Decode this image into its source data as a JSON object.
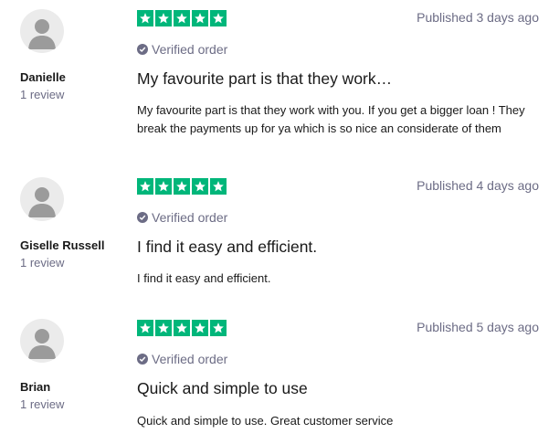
{
  "reviews": [
    {
      "name": "Danielle",
      "count": "1 review",
      "published": "Published 3 days ago",
      "verified": "Verified order",
      "title": "My favourite part is that they work…",
      "body": "My favourite part is that they work with you. If you get a bigger loan ! They break the payments up for ya which is so nice an considerate of them",
      "stars": 5
    },
    {
      "name": "Giselle Russell",
      "count": "1 review",
      "published": "Published 4 days ago",
      "verified": "Verified order",
      "title": "I find it easy and efficient.",
      "body": "I find it easy and efficient.",
      "stars": 5
    },
    {
      "name": "Brian",
      "count": "1 review",
      "published": "Published 5 days ago",
      "verified": "Verified order",
      "title": "Quick and simple to use",
      "body": "Quick and simple to use. Great customer service",
      "stars": 5
    }
  ],
  "colors": {
    "star_green": "#00b67a",
    "muted": "#6c6c85",
    "text": "#191919",
    "avatar_bg": "#ebebeb"
  },
  "icons": {
    "avatar": "avatar-silhouette-icon",
    "star": "star-icon",
    "verified": "check-circle-icon"
  }
}
